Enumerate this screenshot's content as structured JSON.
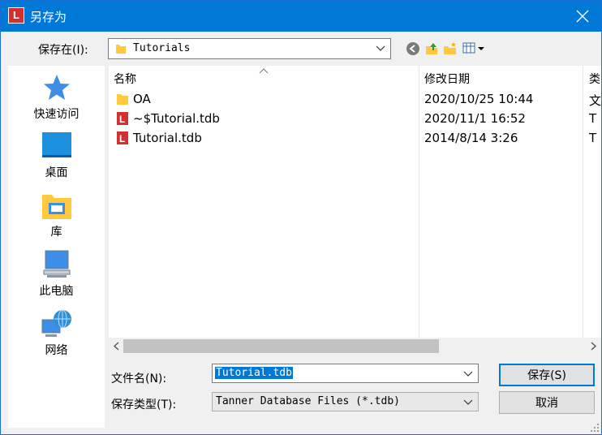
{
  "window": {
    "title": "另存为",
    "app_icon_letter": "L"
  },
  "toolbar": {
    "save_in_label": "保存在(I):",
    "current_folder": "Tutorials"
  },
  "places": [
    {
      "label": "快速访问",
      "icon": "star-icon"
    },
    {
      "label": "桌面",
      "icon": "desktop-icon"
    },
    {
      "label": "库",
      "icon": "library-icon"
    },
    {
      "label": "此电脑",
      "icon": "computer-icon"
    },
    {
      "label": "网络",
      "icon": "network-icon"
    }
  ],
  "filelist": {
    "columns": [
      "名称",
      "修改日期",
      "类"
    ],
    "rows": [
      {
        "name": "OA",
        "date": "2020/10/25 10:44",
        "type": "文",
        "icon": "folder-icon"
      },
      {
        "name": "~$Tutorial.tdb",
        "date": "2020/11/1 16:52",
        "type": "T",
        "icon": "tdb-file-icon"
      },
      {
        "name": "Tutorial.tdb",
        "date": "2014/8/14 3:26",
        "type": "T",
        "icon": "tdb-file-icon"
      }
    ]
  },
  "form": {
    "filename_label": "文件名(N):",
    "filename_value": "Tutorial.tdb",
    "filetype_label": "保存类型(T):",
    "filetype_value": "Tanner Database Files (*.tdb)",
    "save_button": "保存(S)",
    "cancel_button": "取消"
  },
  "colors": {
    "titlebar": "#0078d7",
    "selection": "#0078d7",
    "file_icon_red": "#d32f2f",
    "folder": "#ffc83d"
  }
}
